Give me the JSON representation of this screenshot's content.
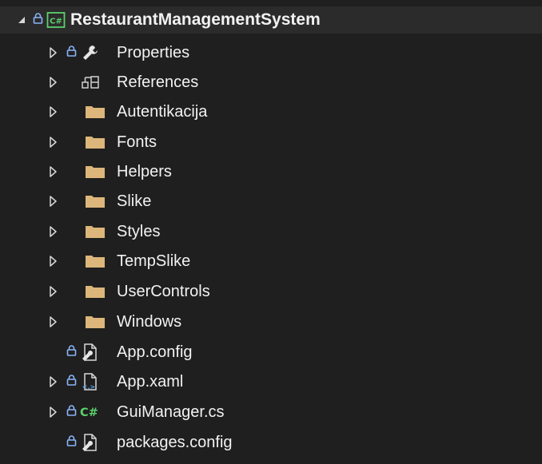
{
  "solution_explorer": {
    "project": {
      "label": "RestaurantManagementSystem",
      "icon": "csharp-project-icon",
      "expanded": true,
      "locked": true
    },
    "items": [
      {
        "label": "Properties",
        "icon": "wrench-icon",
        "expander": true,
        "locked": true
      },
      {
        "label": "References",
        "icon": "references-icon",
        "expander": true,
        "locked": false
      },
      {
        "label": "Autentikacija",
        "icon": "folder-icon",
        "expander": true,
        "locked": false
      },
      {
        "label": "Fonts",
        "icon": "folder-icon",
        "expander": true,
        "locked": false
      },
      {
        "label": "Helpers",
        "icon": "folder-icon",
        "expander": true,
        "locked": false
      },
      {
        "label": "Slike",
        "icon": "folder-icon",
        "expander": true,
        "locked": false
      },
      {
        "label": "Styles",
        "icon": "folder-icon",
        "expander": true,
        "locked": false
      },
      {
        "label": "TempSlike",
        "icon": "folder-icon",
        "expander": true,
        "locked": false
      },
      {
        "label": "UserControls",
        "icon": "folder-icon",
        "expander": true,
        "locked": false
      },
      {
        "label": "Windows",
        "icon": "folder-icon",
        "expander": true,
        "locked": false
      },
      {
        "label": "App.config",
        "icon": "config-file-icon",
        "expander": false,
        "locked": true
      },
      {
        "label": "App.xaml",
        "icon": "xaml-file-icon",
        "expander": true,
        "locked": true
      },
      {
        "label": "GuiManager.cs",
        "icon": "csharp-file-icon",
        "expander": true,
        "locked": true
      },
      {
        "label": "packages.config",
        "icon": "config-file-icon",
        "expander": false,
        "locked": true
      }
    ],
    "colors": {
      "background": "#1f1f1f",
      "selected_row": "#2b2b2b",
      "text": "#f2f2f2",
      "folder": "#dcb67a",
      "csharp_green": "#5bd06c",
      "lock_blue": "#8ab4f8"
    }
  }
}
